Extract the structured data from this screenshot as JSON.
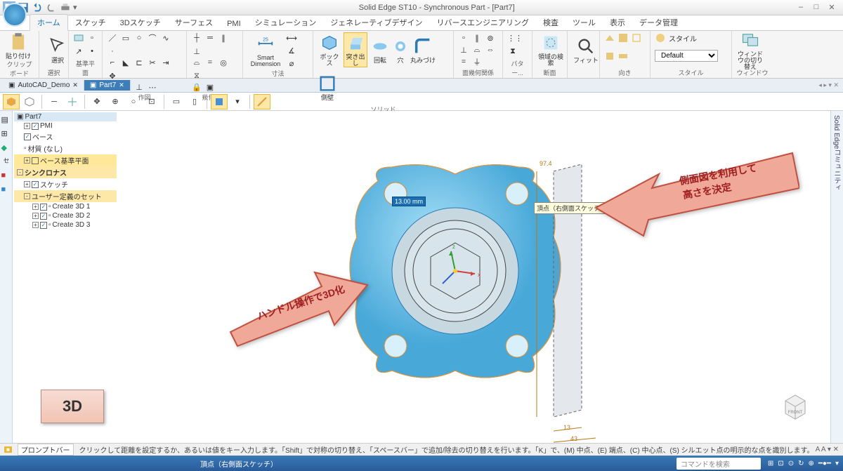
{
  "app": {
    "title": "Solid Edge ST10 - Synchronous Part - [Part7]"
  },
  "ribbon_tabs": [
    "ホーム",
    "スケッチ",
    "3Dスケッチ",
    "サーフェス",
    "PMI",
    "シミュレーション",
    "ジェネレーティブデザイン",
    "リバースエンジニアリング",
    "検査",
    "ツール",
    "表示",
    "データ管理"
  ],
  "ribbon_groups": {
    "clipboard": "クリップボード",
    "select": "選択",
    "plane": "基準平面",
    "draw": "作図",
    "relate": "幾何関係",
    "smartdim": "Smart Dimension",
    "dim": "寸法",
    "solid": "ソリッド",
    "facerel": "面幾何関係",
    "pattern": "パター...",
    "section": "断面",
    "fit": "フィット",
    "orient": "向き",
    "style": "スタイル",
    "window": "ウィンドウ"
  },
  "ribbon_btns": {
    "paste": "貼り付け",
    "select": "選択",
    "box": "ボックス",
    "extrude": "突き出し",
    "revolve": "回転",
    "hole": "穴",
    "round": "丸みづけ",
    "shell": "側壁",
    "section_region": "領域の検索",
    "fit": "フィット",
    "style_lbl": "スタイル",
    "style_val": "Default",
    "win_switch": "ウィンドウの切り替え"
  },
  "doc_tabs": [
    {
      "label": "AutoCAD_Demo",
      "active": false
    },
    {
      "label": "Part7",
      "active": true
    }
  ],
  "tree": {
    "root": "Part7",
    "items": [
      {
        "label": "PMI",
        "lvl": 1,
        "chk": true,
        "tg": "+"
      },
      {
        "label": "ベース",
        "lvl": 1,
        "chk": true,
        "tg": ""
      },
      {
        "label": "材質 (なし)",
        "lvl": 1,
        "chk": false,
        "tg": ""
      },
      {
        "label": "ベース基準平面",
        "lvl": 1,
        "chk": false,
        "tg": "+",
        "hl": true
      },
      {
        "label": "シンクロナス",
        "lvl": 0,
        "chk": false,
        "tg": "-",
        "sel": true
      },
      {
        "label": "スケッチ",
        "lvl": 1,
        "chk": true,
        "tg": "+"
      },
      {
        "label": "ユーザー定義のセット",
        "lvl": 1,
        "chk": false,
        "tg": "-",
        "sel": true
      },
      {
        "label": "Create 3D 1",
        "lvl": 2,
        "chk": true,
        "tg": "+"
      },
      {
        "label": "Create 3D 2",
        "lvl": 2,
        "chk": true,
        "tg": "+"
      },
      {
        "label": "Create 3D 3",
        "lvl": 2,
        "chk": true,
        "tg": "+"
      }
    ]
  },
  "callouts": {
    "left": "ハンドル操作で3D化",
    "right_l1": "側面図を利用して",
    "right_l2": "高さを決定"
  },
  "canvas": {
    "dim_value": "13.00 mm",
    "tooltip": "頂点（右側面スケッチ）",
    "dim_h": "97.4",
    "dim_b1": "13",
    "dim_b2": "43"
  },
  "badge": "3D",
  "viewcube": "FRONT",
  "prompt": {
    "label": "プロンプトバー",
    "text": "クリックして距離を設定するか、あるいは値をキー入力します。「Shift」で対称の切り替え、「スペースバー」で追加/除去の切り替えを行います。「K」で、(M) 中点、(E) 端点、(C) 中心点、(S) シルエット点の明示的な点を識別します。"
  },
  "taskbar": {
    "status": "頂点（右側面スケッチ）",
    "cmd_placeholder": "コマンドを検索"
  },
  "rightbar": "Solid Edgeコミュニティ"
}
